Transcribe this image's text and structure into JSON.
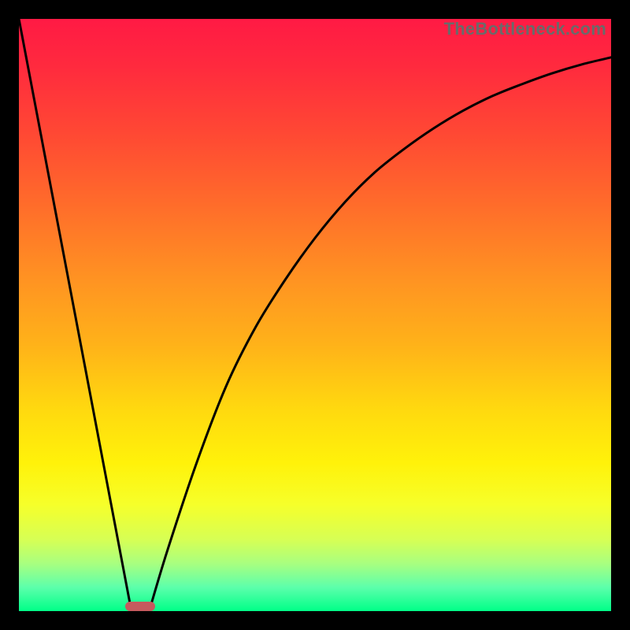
{
  "watermark": "TheBottleneck.com",
  "colors": {
    "frame": "#000000",
    "curve": "#000000",
    "marker": "#c65a5e",
    "gradient_top": "#ff1a44",
    "gradient_bottom": "#00ff88"
  },
  "chart_data": {
    "type": "line",
    "title": "",
    "xlabel": "",
    "ylabel": "",
    "xlim": [
      0,
      100
    ],
    "ylim": [
      0,
      100
    ],
    "grid": false,
    "legend": false,
    "series": [
      {
        "name": "left-line",
        "x": [
          0,
          19
        ],
        "values": [
          100,
          0
        ]
      },
      {
        "name": "right-curve",
        "x": [
          22,
          25,
          30,
          35,
          40,
          45,
          50,
          55,
          60,
          65,
          70,
          75,
          80,
          85,
          90,
          95,
          100
        ],
        "values": [
          0,
          10,
          25,
          38,
          48,
          56,
          63,
          69,
          74,
          78,
          81.5,
          84.5,
          87,
          89,
          90.8,
          92.3,
          93.5
        ]
      }
    ],
    "marker": {
      "x_center": 20.5,
      "width": 5,
      "height": 1.6
    }
  }
}
